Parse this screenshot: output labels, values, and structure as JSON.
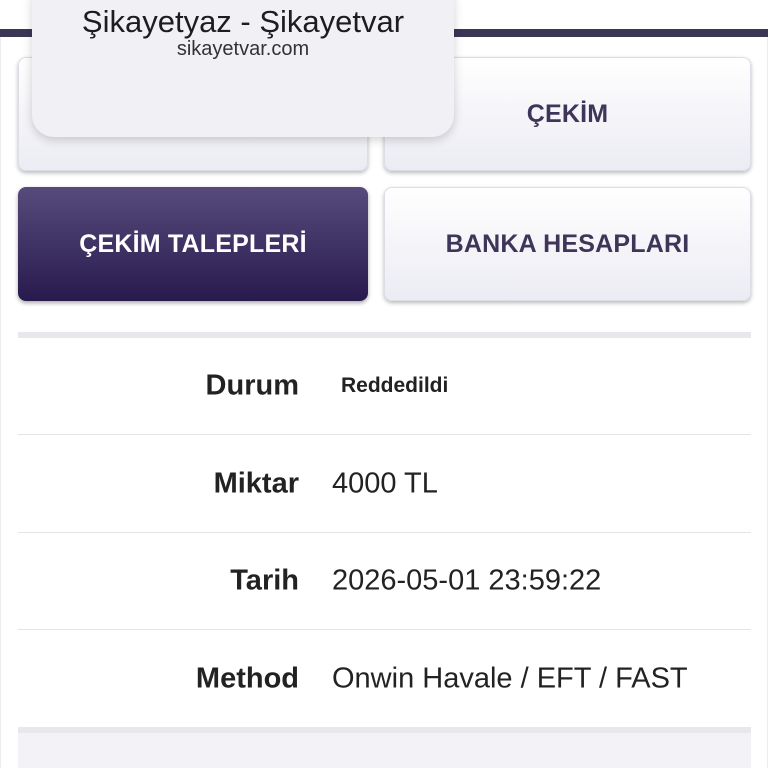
{
  "popup": {
    "title": "Şikayetyaz - Şikayetvar",
    "url": "sikayetvar.com"
  },
  "tiles": [
    {
      "label": ""
    },
    {
      "label": "ÇEKİM"
    },
    {
      "label": "ÇEKİM TALEPLERİ"
    },
    {
      "label": "BANKA HESAPLARI"
    }
  ],
  "details": [
    {
      "label": "Durum",
      "value": "Reddedildi"
    },
    {
      "label": "Miktar",
      "value": "4000 TL"
    },
    {
      "label": "Tarih",
      "value": "2026-05-01 23:59:22"
    },
    {
      "label": "Method",
      "value": "Onwin Havale / EFT / FAST"
    }
  ],
  "colors": {
    "accent_dark": "#2e2052",
    "tile_text": "#3e3559",
    "top_bar": "#3d3556"
  }
}
